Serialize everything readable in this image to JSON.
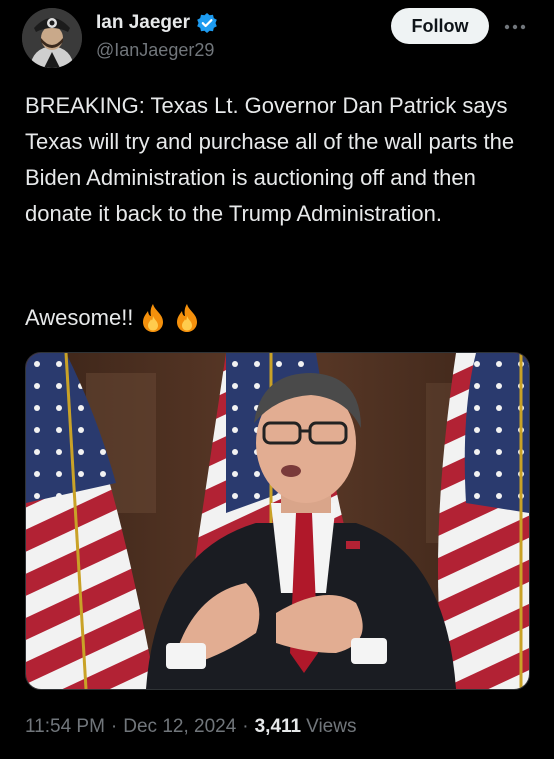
{
  "author": {
    "display_name": "Ian Jaeger",
    "handle": "@IanJaeger29",
    "verified": true,
    "avatar_icon": "avatar-pirate-helmet-icon"
  },
  "actions": {
    "follow_label": "Follow",
    "more_icon": "more-options-icon"
  },
  "tweet": {
    "text": "BREAKING: Texas Lt. Governor Dan Patrick says Texas will try and purchase all of the wall parts the Biden Administration is auctioning off and then donate it back to the Trump Administration.",
    "second_line": "Awesome!!",
    "emojis": [
      "fire-emoji",
      "fire-emoji"
    ]
  },
  "media": {
    "type": "photo",
    "icon": "photo-man-speaking-with-american-flags"
  },
  "meta": {
    "time": "11:54 PM",
    "separator": "·",
    "date": "Dec 12, 2024",
    "views_count": "3,411",
    "views_label": "Views"
  },
  "colors": {
    "background": "#000000",
    "text": "#e7e9ea",
    "secondary_text": "#71767b",
    "verified": "#1d9bf0",
    "follow_bg": "#eff3f4"
  }
}
